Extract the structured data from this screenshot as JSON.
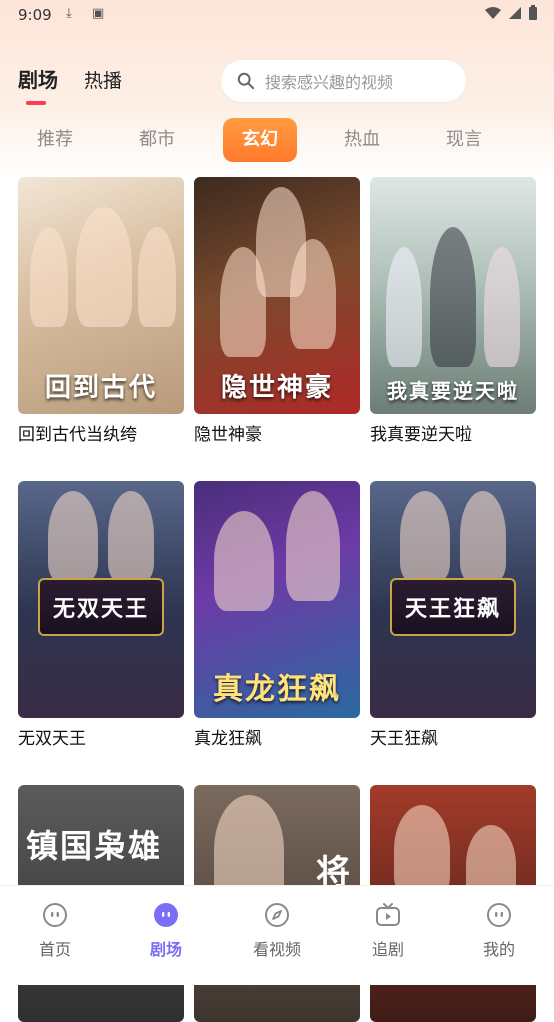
{
  "status": {
    "time": "9:09"
  },
  "top_tabs": [
    {
      "label": "剧场",
      "active": true
    },
    {
      "label": "热播",
      "active": false
    }
  ],
  "search": {
    "placeholder": "搜索感兴趣的视频"
  },
  "categories": [
    {
      "label": "推荐",
      "active": false
    },
    {
      "label": "都市",
      "active": false
    },
    {
      "label": "玄幻",
      "active": true
    },
    {
      "label": "热血",
      "active": false
    },
    {
      "label": "现言",
      "active": false
    }
  ],
  "dramas": [
    {
      "title": "回到古代当纨绔",
      "poster_text": "回到古代"
    },
    {
      "title": "隐世神豪",
      "poster_text": "隐世神豪"
    },
    {
      "title": "我真要逆天啦",
      "poster_text": "我真要逆天啦"
    },
    {
      "title": "无双天王",
      "poster_text": "无双天王"
    },
    {
      "title": "真龙狂飙",
      "poster_text": "真龙狂飙"
    },
    {
      "title": "天王狂飙",
      "poster_text": "天王狂飙"
    },
    {
      "title": "",
      "poster_text": "镇国枭雄"
    },
    {
      "title": "",
      "poster_text": "将"
    },
    {
      "title": "",
      "poster_text": ""
    }
  ],
  "bottom_nav": [
    {
      "label": "首页",
      "icon": "home-face-icon",
      "active": false
    },
    {
      "label": "剧场",
      "icon": "theater-face-icon",
      "active": true
    },
    {
      "label": "看视频",
      "icon": "compass-icon",
      "active": false
    },
    {
      "label": "追剧",
      "icon": "tv-play-icon",
      "active": false
    },
    {
      "label": "我的",
      "icon": "profile-face-icon",
      "active": false
    }
  ],
  "colors": {
    "accent": "#ff7a2c",
    "nav_active": "#7b6df6",
    "tab_underline": "#ff3b4e"
  }
}
